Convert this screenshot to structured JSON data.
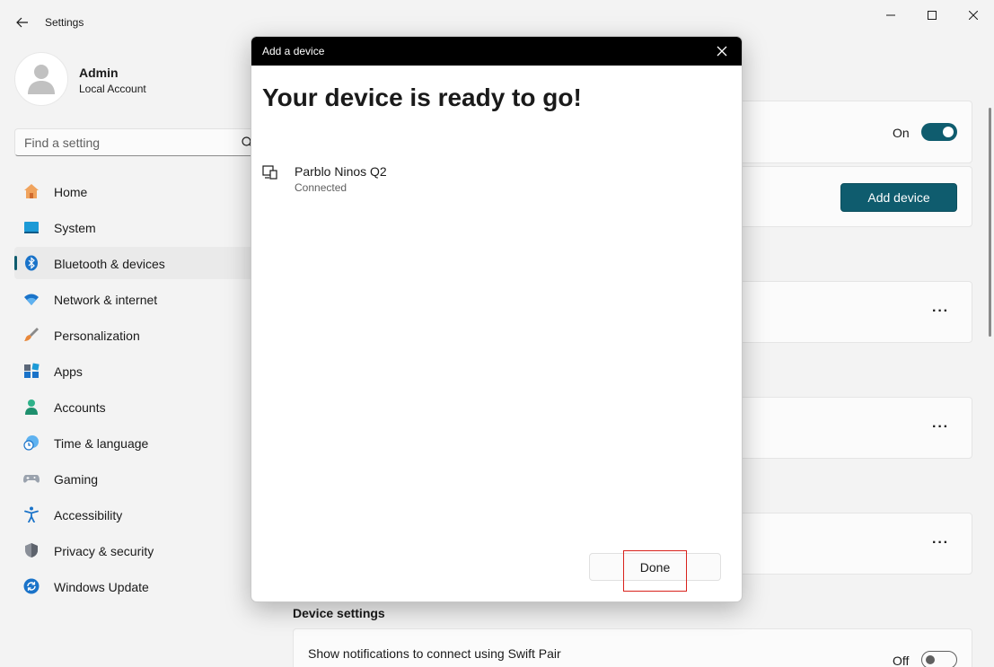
{
  "window": {
    "title": "Settings"
  },
  "profile": {
    "name": "Admin",
    "account_type": "Local Account"
  },
  "search": {
    "placeholder": "Find a setting"
  },
  "nav": {
    "items": [
      {
        "label": "Home",
        "icon": "home-icon"
      },
      {
        "label": "System",
        "icon": "system-icon"
      },
      {
        "label": "Bluetooth & devices",
        "icon": "bluetooth-icon",
        "active": true
      },
      {
        "label": "Network & internet",
        "icon": "wifi-icon"
      },
      {
        "label": "Personalization",
        "icon": "brush-icon"
      },
      {
        "label": "Apps",
        "icon": "apps-icon"
      },
      {
        "label": "Accounts",
        "icon": "person-icon"
      },
      {
        "label": "Time & language",
        "icon": "clock-globe-icon"
      },
      {
        "label": "Gaming",
        "icon": "gamepad-icon"
      },
      {
        "label": "Accessibility",
        "icon": "accessibility-icon"
      },
      {
        "label": "Privacy & security",
        "icon": "shield-icon"
      },
      {
        "label": "Windows Update",
        "icon": "update-icon"
      }
    ]
  },
  "content": {
    "bluetooth_toggle_label": "On",
    "add_device_label": "Add device",
    "more_label": "···",
    "device_settings_title": "Device settings",
    "swift_pair_title": "Show notifications to connect using Swift Pair",
    "swift_pair_toggle_label": "Off"
  },
  "dialog": {
    "title": "Add a device",
    "heading": "Your device is ready to go!",
    "device_name": "Parblo Ninos Q2",
    "device_status": "Connected",
    "done_label": "Done"
  },
  "colors": {
    "accent": "#0f5c6e",
    "highlight": "#d9221c"
  }
}
